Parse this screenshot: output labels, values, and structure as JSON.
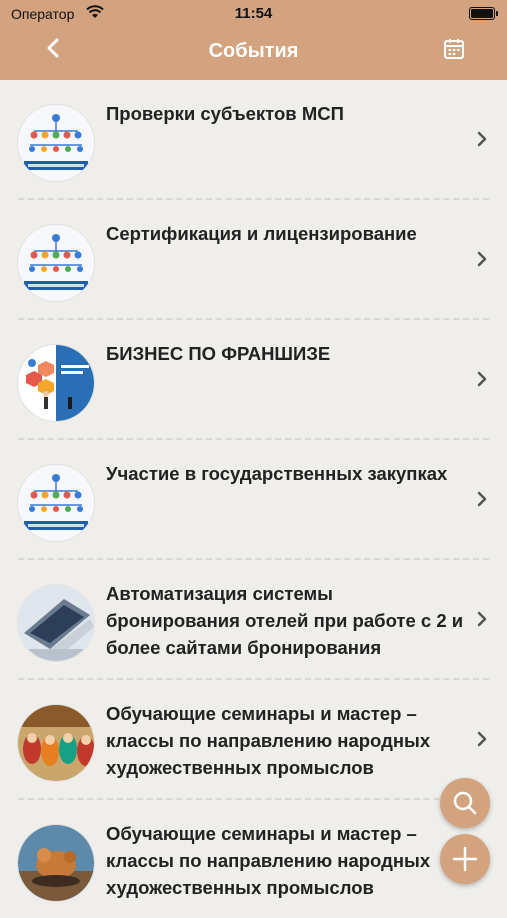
{
  "status_bar": {
    "carrier": "Оператор",
    "time": "11:54"
  },
  "navbar": {
    "title": "События",
    "back_icon": "chevron-left-icon",
    "calendar_icon": "calendar-icon"
  },
  "events": [
    {
      "title": "Проверки субъектов МСП",
      "thumb": "org-chart"
    },
    {
      "title": "Сертификация и лицензирование",
      "thumb": "org-chart"
    },
    {
      "title": "БИЗНЕС ПО ФРАНШИЗЕ",
      "thumb": "franchise"
    },
    {
      "title": "Участие в государственных закупках",
      "thumb": "org-chart"
    },
    {
      "title": "Автоматизация системы бронирования отелей при работе с 2 и более сайтами бронирования",
      "thumb": "laptop"
    },
    {
      "title": "Обучающие семинары и мастер – классы по направлению народных художественных промыслов",
      "thumb": "dolls"
    },
    {
      "title": "Обучающие семинары и мастер – классы по направлению народных художественных промыслов",
      "thumb": "crafts"
    }
  ],
  "fabs": {
    "search_icon": "search-icon",
    "add_icon": "plus-icon"
  },
  "colors": {
    "accent": "#d3a27f",
    "background": "#efeeea"
  }
}
